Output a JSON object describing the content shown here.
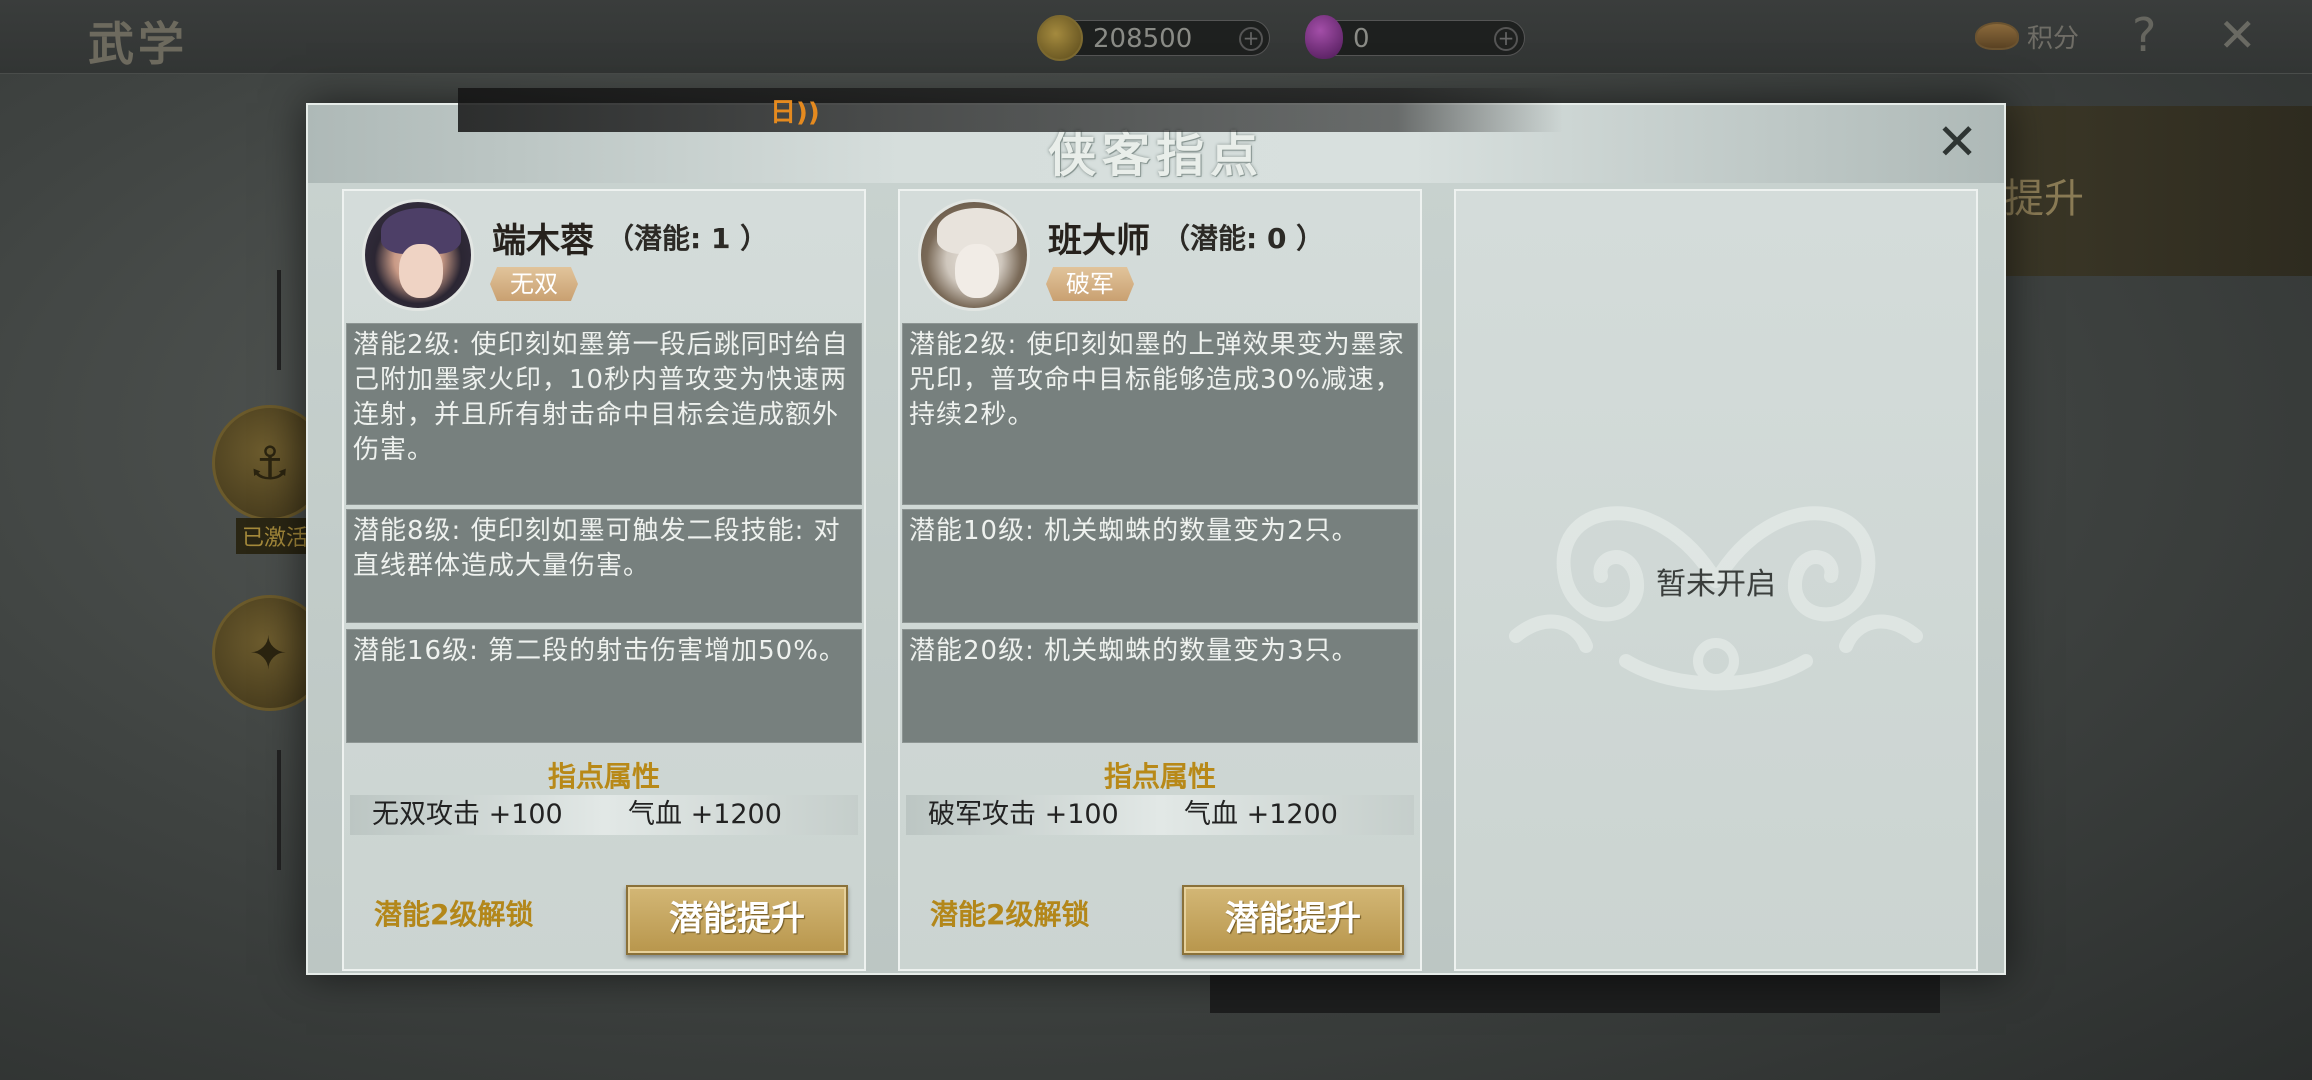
{
  "app": {
    "title": "武学",
    "coins": "208500",
    "gems": "0",
    "points_label": "积分",
    "help_label": "?",
    "close_label": "✕",
    "side_caption": "已激活",
    "right_panel_text": "提升"
  },
  "dialog": {
    "title": "侠客指点",
    "close_label": "✕",
    "notification_icon": "日))"
  },
  "cards": [
    {
      "name": "端木蓉",
      "potential": "（潜能: 1 ）",
      "tag": "无双",
      "skills": [
        "潜能2级: 使印刻如墨第一段后跳同时给自己附加墨家火印，10秒内普攻变为快速两连射，并且所有射击命中目标会造成额外伤害。",
        "潜能8级: 使印刻如墨可触发二段技能: 对直线群体造成大量伤害。",
        "潜能16级: 第二段的射击伤害增加50%。"
      ],
      "attr_title": "指点属性",
      "attr1": "无双攻击 +100",
      "attr2": "气血 +1200",
      "unlock_text": "潜能2级解锁",
      "button_label": "潜能提升"
    },
    {
      "name": "班大师",
      "potential": "（潜能: 0 ）",
      "tag": "破军",
      "skills": [
        "潜能2级: 使印刻如墨的上弹效果变为墨家咒印，普攻命中目标能够造成30%减速，持续2秒。",
        "潜能10级: 机关蜘蛛的数量变为2只。",
        "潜能20级: 机关蜘蛛的数量变为3只。"
      ],
      "attr_title": "指点属性",
      "attr1": "破军攻击 +100",
      "attr2": "气血 +1200",
      "unlock_text": "潜能2级解锁",
      "button_label": "潜能提升"
    }
  ],
  "locked_slot": {
    "text": "暂未开启"
  },
  "colors": {
    "accent_gold": "#b88918",
    "skill_box": "#77807e",
    "dialog_bg": "#c9d3d0"
  },
  "icons": {
    "coin": "coin-icon",
    "gem": "gem-icon",
    "points": "points-icon",
    "help": "help-icon",
    "close": "close-icon",
    "notification": "notification-icon"
  }
}
